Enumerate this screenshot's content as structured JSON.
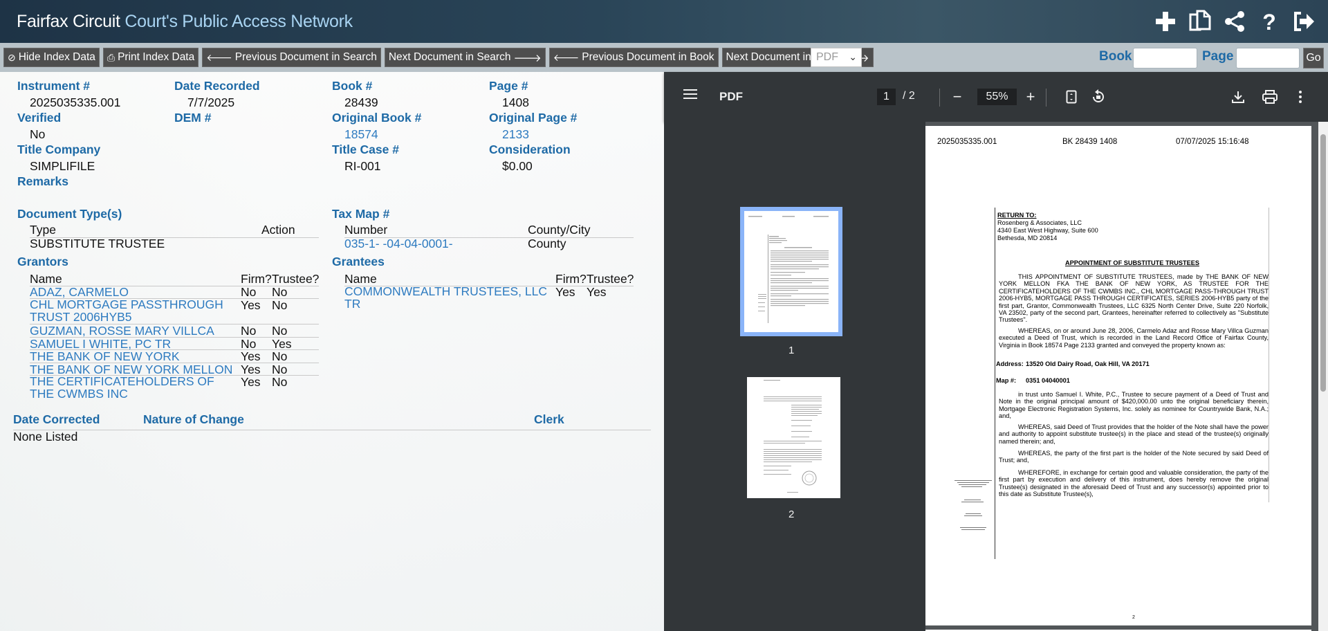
{
  "header": {
    "title_main": "Fairfax Circuit",
    "title_sub": "Court's Public Access Network",
    "icons": [
      "plus-icon",
      "copy-icon",
      "share-icon",
      "help-icon",
      "logout-icon"
    ]
  },
  "toolbar": {
    "hide_index": "Hide Index Data",
    "print_index": "Print Index Data",
    "prev_search": "Previous Document in Search",
    "next_search": "Next Document in Search",
    "prev_book": "Previous Document in Book",
    "next_book": "Next Document in Book",
    "format_selected": "PDF",
    "book_label": "Book",
    "book_value": "",
    "page_label": "Page",
    "page_value": "",
    "go_label": "Go"
  },
  "record": {
    "instrument_label": "Instrument #",
    "instrument": "2025035335.001",
    "date_recorded_label": "Date Recorded",
    "date_recorded": "7/7/2025",
    "book_label": "Book #",
    "book": "28439",
    "page_label": "Page #",
    "page": "1408",
    "verified_label": "Verified",
    "verified": "No",
    "dem_label": "DEM #",
    "orig_book_label": "Original Book #",
    "orig_book": "18574",
    "orig_page_label": "Original Page #",
    "orig_page": "2133",
    "title_company_label": "Title Company",
    "title_company": "SIMPLIFILE",
    "title_case_label": "Title Case #",
    "title_case": "RI-001",
    "consideration_label": "Consideration",
    "consideration": "$0.00",
    "remarks_label": "Remarks",
    "doc_types_label": "Document Type(s)",
    "doc_types_headers": {
      "type": "Type",
      "action": "Action"
    },
    "doc_types": [
      {
        "type": "SUBSTITUTE TRUSTEE",
        "action": ""
      }
    ],
    "taxmap_label": "Tax Map #",
    "taxmap_headers": {
      "number": "Number",
      "county": "County/City"
    },
    "taxmap": [
      {
        "number": "035-1- -04-04-0001-",
        "county": "County"
      }
    ],
    "grantors_label": "Grantors",
    "party_headers": {
      "name": "Name",
      "firm": "Firm?",
      "trustee": "Trustee?"
    },
    "grantors": [
      {
        "name": "ADAZ, CARMELO",
        "firm": "No",
        "trustee": "No"
      },
      {
        "name": "CHL MORTGAGE PASSTHROUGH TRUST 2006HYB5",
        "firm": "Yes",
        "trustee": "No"
      },
      {
        "name": "GUZMAN, ROSSE MARY VILLCA",
        "firm": "No",
        "trustee": "No"
      },
      {
        "name": "SAMUEL I WHITE, PC TR",
        "firm": "No",
        "trustee": "Yes"
      },
      {
        "name": "THE BANK OF NEW YORK",
        "firm": "Yes",
        "trustee": "No"
      },
      {
        "name": "THE BANK OF NEW YORK MELLON",
        "firm": "Yes",
        "trustee": "No"
      },
      {
        "name": "THE CERTIFICATEHOLDERS OF THE CWMBS INC",
        "firm": "Yes",
        "trustee": "No"
      }
    ],
    "grantees_label": "Grantees",
    "grantees": [
      {
        "name": "COMMONWEALTH TRUSTEES, LLC TR",
        "firm": "Yes",
        "trustee": "Yes"
      }
    ],
    "corrections_headers": {
      "date": "Date Corrected",
      "nature": "Nature of Change",
      "clerk": "Clerk"
    },
    "corrections_value": "None Listed"
  },
  "viewer": {
    "title": "PDF",
    "current_page": "1",
    "total_pages": "/  2",
    "zoom": "55%",
    "thumbnails": [
      {
        "label": "1"
      },
      {
        "label": "2"
      }
    ],
    "document": {
      "header_instrument": "2025035335.001",
      "header_book": "BK 28439 1408",
      "header_datetime": "07/07/2025 15:16:48",
      "return_to": "RETURN TO:",
      "return_lines": [
        "Rosenberg & Associates, LLC",
        "4340 East West Highway, Suite 600",
        "Bethesda, MD 20814"
      ],
      "heading": "APPOINTMENT OF SUBSTITUTE TRUSTEES",
      "para1": "THIS APPOINTMENT OF SUBSTITUTE TRUSTEES, made by THE BANK OF NEW YORK MELLON FKA THE BANK OF NEW YORK, AS TRUSTEE FOR THE CERTIFICATEHOLDERS OF THE CWMBS INC., CHL MORTGAGE PASS-THROUGH TRUST 2006-HYB5, MORTGAGE PASS THROUGH CERTIFICATES, SERIES 2006-HYB5 party of the first part, Grantor, Commonwealth Trustees, LLC 6325 North Center Drive, Suite 220 Norfolk, VA 23502, party of the second part, Grantees, hereinafter referred to collectively as \"Substitute Trustees\".",
      "para2": "WHEREAS, on or around June 28, 2006, Carmelo Adaz and Rosse Mary Villca Guzman executed a Deed of Trust, which is recorded in the Land Record Office of Fairfax County, Virginia in Book 18574 Page 2133 granted and conveyed the property known as:",
      "address_label": "Address:",
      "address": "13520 Old Dairy Road, Oak Hill, VA 20171",
      "map_label": "Map #:",
      "map": "0351 04040001",
      "para3": "in trust unto Samuel I. White, P.C., Trustee to secure payment of a Deed of Trust and Note in the original principal amount of $420,000.00 unto the original beneficiary therein, Mortgage Electronic Registration Systems, Inc. solely as nominee for Countrywide Bank, N.A.; and,",
      "para4": "WHEREAS, said Deed of Trust provides that the holder of the Note shall have the power and authority to appoint substitute trustee(s) in the place and stead of the trustee(s) originally named therein; and,",
      "para5": "WHEREAS, the party of the first part is the holder of the Note secured by said Deed of Trust; and,",
      "para6": "WHEREFORE, in exchange for certain good and valuable consideration, the party of the first part by execution and delivery of this instrument, does hereby remove the original Trustee(s) designated in the aforesaid Deed of Trust and any successor(s) appointed prior to this date as Substitute Trustee(s),",
      "footer_num": "2"
    }
  }
}
